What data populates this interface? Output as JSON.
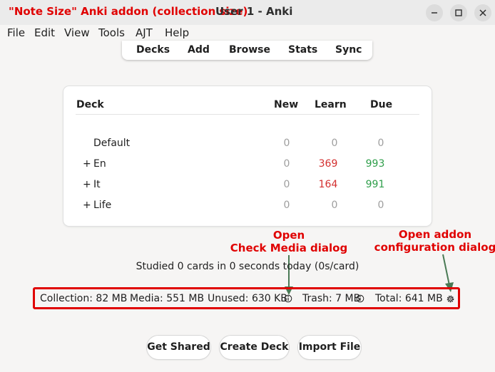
{
  "window": {
    "annotation_title": "\"Note Size\" Anki addon (collection size)",
    "title": "User 1 - Anki"
  },
  "menu": [
    "File",
    "Edit",
    "View",
    "Tools",
    "AJT",
    "Help"
  ],
  "toolbar": [
    "Decks",
    "Add",
    "Browse",
    "Stats",
    "Sync"
  ],
  "deck_table": {
    "headers": {
      "deck": "Deck",
      "new": "New",
      "learn": "Learn",
      "due": "Due"
    },
    "rows": [
      {
        "expander": "",
        "name": "Default",
        "new": "0",
        "learn": "0",
        "due": "0"
      },
      {
        "expander": "+",
        "name": "En",
        "new": "0",
        "learn": "369",
        "due": "993"
      },
      {
        "expander": "+",
        "name": "It",
        "new": "0",
        "learn": "164",
        "due": "991"
      },
      {
        "expander": "+",
        "name": "Life",
        "new": "0",
        "learn": "0",
        "due": "0"
      }
    ]
  },
  "studied_text": "Studied 0 cards in 0 seconds today (0s/card)",
  "status": {
    "collection": "Collection: 82 MB",
    "media": "Media: 551 MB",
    "unused": "Unused: 630 KB",
    "trash": "Trash: 7 MB",
    "total": "Total: 641 MB"
  },
  "annotations": {
    "check_media": [
      "Open",
      "Check Media dialog"
    ],
    "addon_config": [
      "Open addon",
      "configuration dialog"
    ]
  },
  "buttons": {
    "get_shared": "Get Shared",
    "create_deck": "Create Deck",
    "import_file": "Import File"
  },
  "colors": {
    "annotation_red": "#e00000",
    "learn": "#d32f2f",
    "due": "#2e9e4a",
    "zero": "#9e9e9e",
    "arrow": "#4a7a55"
  },
  "icons": [
    "minimize-icon",
    "maximize-icon",
    "close-icon",
    "info-icon",
    "gear-icon"
  ]
}
